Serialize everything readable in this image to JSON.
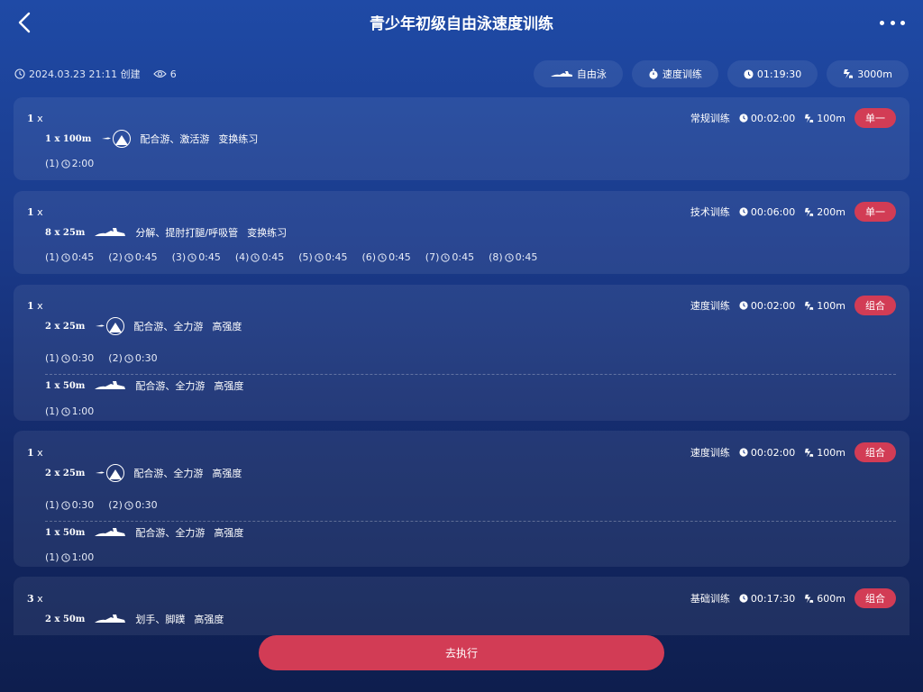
{
  "header": {
    "title": "青少年初级自由泳速度训练",
    "back_icon": "chevron-left-icon",
    "more_icon": "more-dots-icon"
  },
  "meta": {
    "created": "2024.03.23 21:11 创建",
    "views": "6"
  },
  "chips": {
    "stroke": "自由泳",
    "type": "速度训练",
    "duration": "01:19:30",
    "distance": "3000m"
  },
  "cards": [
    {
      "rep": "1",
      "rep_suffix": "x",
      "category": "常规训练",
      "duration": "00:02:00",
      "distance": "100m",
      "badge": "单一",
      "sets": [
        {
          "qty": "1 x 100m",
          "desc": "配合游、激活游",
          "desc2": "变换练习",
          "times": [
            {
              "idx": "(1)",
              "time": "2:00"
            }
          ]
        }
      ]
    },
    {
      "rep": "1",
      "rep_suffix": "x",
      "category": "技术训练",
      "duration": "00:06:00",
      "distance": "200m",
      "badge": "单一",
      "sets": [
        {
          "qty": "8 x 25m",
          "desc": "分解、提肘打腿/呼吸管",
          "desc2": "变换练习",
          "times": [
            {
              "idx": "(1)",
              "time": "0:45"
            },
            {
              "idx": "(2)",
              "time": "0:45"
            },
            {
              "idx": "(3)",
              "time": "0:45"
            },
            {
              "idx": "(4)",
              "time": "0:45"
            },
            {
              "idx": "(5)",
              "time": "0:45"
            },
            {
              "idx": "(6)",
              "time": "0:45"
            },
            {
              "idx": "(7)",
              "time": "0:45"
            },
            {
              "idx": "(8)",
              "time": "0:45"
            }
          ]
        }
      ]
    },
    {
      "rep": "1",
      "rep_suffix": "x",
      "category": "速度训练",
      "duration": "00:02:00",
      "distance": "100m",
      "badge": "组合",
      "sets": [
        {
          "qty": "2 x 25m",
          "desc": "配合游、全力游",
          "desc2": "高强度",
          "times": [
            {
              "idx": "(1)",
              "time": "0:30"
            },
            {
              "idx": "(2)",
              "time": "0:30"
            }
          ]
        },
        {
          "qty": "1 x 50m",
          "desc": "配合游、全力游",
          "desc2": "高强度",
          "times": [
            {
              "idx": "(1)",
              "time": "1:00"
            }
          ]
        }
      ]
    },
    {
      "rep": "1",
      "rep_suffix": "x",
      "category": "速度训练",
      "duration": "00:02:00",
      "distance": "100m",
      "badge": "组合",
      "sets": [
        {
          "qty": "2 x 25m",
          "desc": "配合游、全力游",
          "desc2": "高强度",
          "times": [
            {
              "idx": "(1)",
              "time": "0:30"
            },
            {
              "idx": "(2)",
              "time": "0:30"
            }
          ]
        },
        {
          "qty": "1 x 50m",
          "desc": "配合游、全力游",
          "desc2": "高强度",
          "times": [
            {
              "idx": "(1)",
              "time": "1:00"
            }
          ]
        }
      ]
    },
    {
      "rep": "3",
      "rep_suffix": "x",
      "category": "基础训练",
      "duration": "00:17:30",
      "distance": "600m",
      "badge": "组合",
      "sets": [
        {
          "qty": "2 x 50m",
          "desc": "划手、脚蹼",
          "desc2": "高强度",
          "times": []
        }
      ]
    }
  ],
  "actions": {
    "go": "去执行"
  },
  "colors": {
    "accent": "#d23c55",
    "bg_top": "#1f4aa6",
    "bg_bottom": "#0e1e4e"
  }
}
